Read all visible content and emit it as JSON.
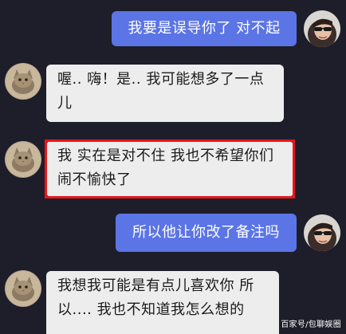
{
  "messages": [
    {
      "side": "out",
      "lines": [
        "我要是误导你了 对不起"
      ]
    },
    {
      "side": "in",
      "lines": [
        "喔.. 嗨！是.. 我可能想多了一点",
        "儿"
      ]
    },
    {
      "side": "in",
      "lines": [
        "我 实在是对不住 我也不希望你们",
        "闹不愉快了"
      ],
      "highlighted": true
    },
    {
      "side": "out",
      "lines": [
        "所以他让你改了备注吗"
      ]
    },
    {
      "side": "in",
      "lines": [
        "我想我可能是有点儿喜欢你 所",
        "以.... 我也不知道我怎么想的"
      ]
    }
  ],
  "avatars": {
    "self": "user-avatar-sunglasses",
    "other": "contact-avatar-cat"
  },
  "watermark": "百家号/包聊娱圈",
  "colors": {
    "background": "#1e1e2a",
    "outgoing_bubble": "#5b74e6",
    "incoming_bubble": "#ededed",
    "highlight_border": "#e8161e"
  }
}
